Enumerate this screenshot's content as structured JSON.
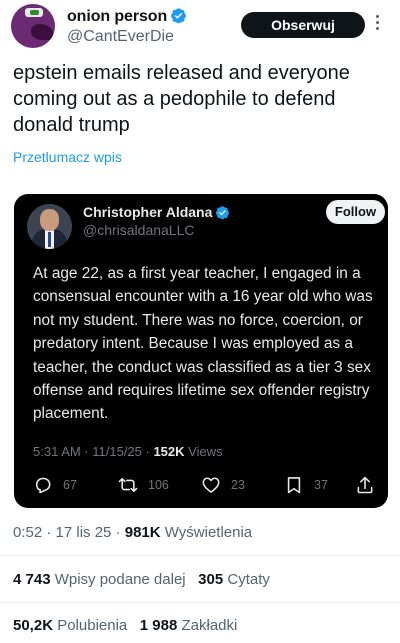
{
  "author": {
    "display_name": "onion person",
    "handle": "@CantEverDie",
    "follow_label": "Obserwuj"
  },
  "tweet": {
    "text": "epstein emails released and everyone coming out as a pedophile to defend donald trump",
    "translate_label": "Przetlumacz wpis"
  },
  "quote": {
    "display_name": "Christopher Aldana",
    "handle": "@chrisaldanaLLC",
    "follow_label": "Follow",
    "text": "At age 22, as a first year teacher, I engaged in a consensual encounter with a 16 year old who was not my student. There was no force, coercion, or predatory intent. Because I was employed as a teacher, the conduct was classified as a tier 3 sex offense and requires lifetime sex offender registry placement.",
    "time": "5:31 AM · 11/15/25 · ",
    "views_count": "152K",
    "views_label": " Views",
    "replies": "67",
    "reposts": "106",
    "likes": "23",
    "bookmarks": "37"
  },
  "meta": {
    "time": "0:52 · 17 lis 25 · ",
    "views_count": "981K",
    "views_label": " Wyświetlenia"
  },
  "stats": {
    "reposts_count": "4 743",
    "reposts_label": " Wpisy podane dalej",
    "quotes_count": "305",
    "quotes_label": " Cytaty",
    "likes_count": "50,2K",
    "likes_label": " Polubienia",
    "bookmarks_count": "1 988",
    "bookmarks_label": " Zakładki"
  },
  "colors": {
    "accent": "#1d9bf0",
    "text": "#0f1419",
    "muted": "#536471",
    "quote_bg": "#000000"
  },
  "icons": [
    "verified-icon",
    "more-icon",
    "reply-icon",
    "repost-icon",
    "like-icon",
    "bookmark-icon",
    "share-icon"
  ]
}
